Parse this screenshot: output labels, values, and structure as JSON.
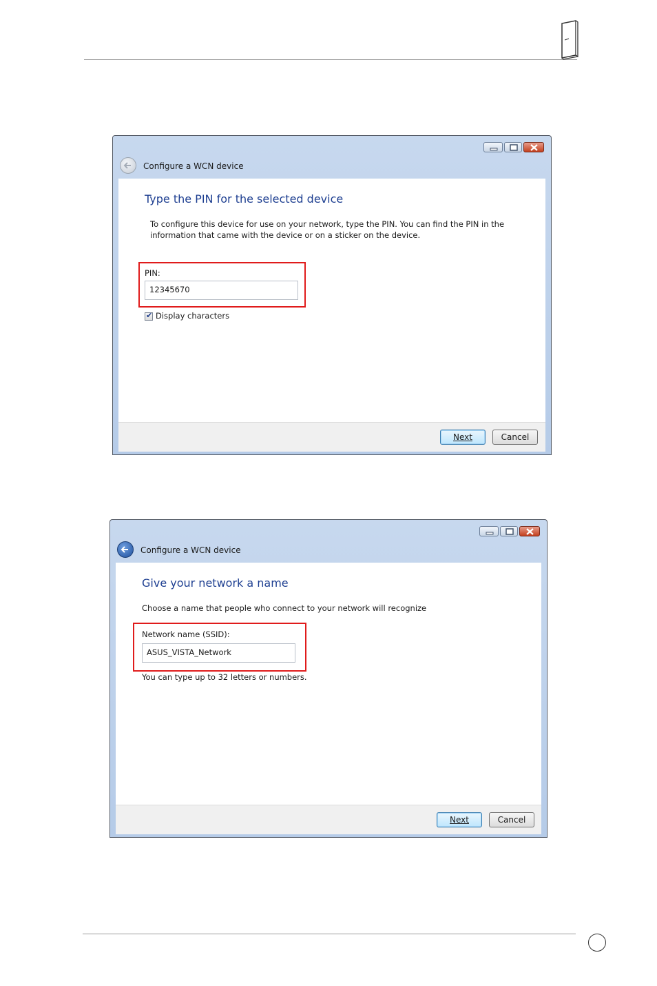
{
  "dialog1": {
    "title": "Configure a WCN device",
    "heading": "Type the PIN for the selected device",
    "description_line1": "To configure this device for use on your network, type the PIN. You can find the PIN in the",
    "description_line2": "information that came with the device or on a sticker on the device.",
    "pin_label": "PIN:",
    "pin_value": "12345670",
    "display_chars_label": "Display characters",
    "display_chars_checked": true,
    "next_label": "Next",
    "cancel_label": "Cancel"
  },
  "dialog2": {
    "title": "Configure a WCN device",
    "heading": "Give your network a name",
    "description": "Choose a name that people who connect to your network will recognize",
    "ssid_label": "Network name (SSID):",
    "ssid_value": "ASUS_VISTA_Network",
    "hint": "You can type up to 32 letters or numbers.",
    "next_label": "Next",
    "cancel_label": "Cancel"
  },
  "icons": {
    "back": "back-arrow-icon",
    "minimize": "minimize-icon",
    "maximize": "maximize-icon",
    "close": "close-icon",
    "device": "router-device-icon"
  },
  "colors": {
    "highlight": "#e01b1b",
    "heading": "#1e3f91",
    "titlebar": "#b5cbe8"
  }
}
